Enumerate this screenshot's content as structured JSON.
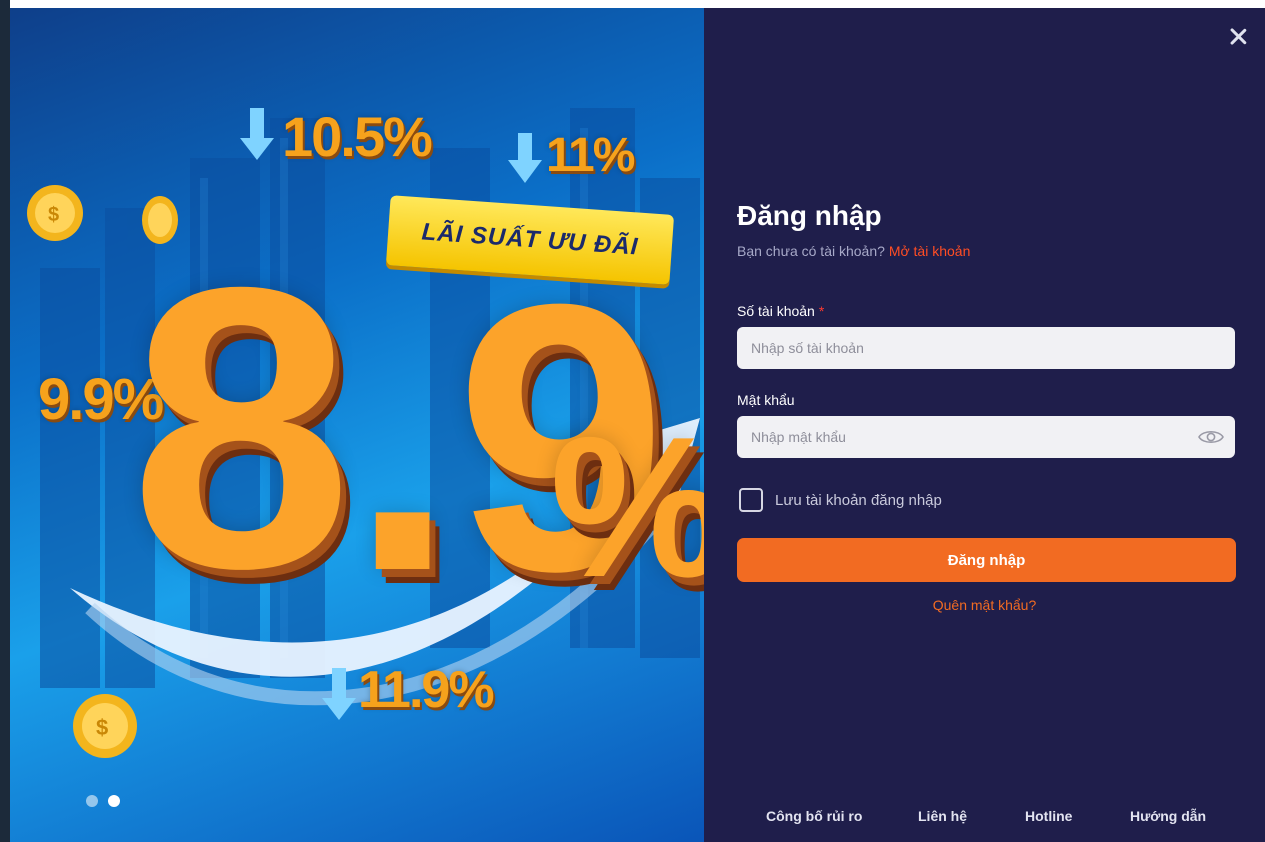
{
  "promo": {
    "ribbon_text": "LÃI SUẤT ƯU ĐÃI",
    "big_rate_integer": "8",
    "big_rate_decimal": ".9",
    "big_percent": "%",
    "rates": [
      "10.5%",
      "11%",
      "9.9%",
      "11.9%"
    ],
    "carousel": {
      "total": 2,
      "active_index": 1
    }
  },
  "login": {
    "title": "Đăng nhập",
    "no_account_text": "Bạn chưa có tài khoản?",
    "open_account_link": "Mở tài khoản",
    "account_label": "Số tài khoản",
    "required_mark": "*",
    "account_placeholder": "Nhập số tài khoản",
    "password_label": "Mật khẩu",
    "password_placeholder": "Nhập mật khẩu",
    "remember_label": "Lưu tài khoản đăng nhập",
    "remember_checked": false,
    "submit_label": "Đăng nhập",
    "forgot_link": "Quên mật khẩu?"
  },
  "footer": {
    "links": [
      "Công bố rủi ro",
      "Liên hệ",
      "Hotline",
      "Hướng dẫn"
    ]
  },
  "colors": {
    "panel_bg": "#1f1e4b",
    "accent": "#f26b22",
    "link_red": "#ff4d24",
    "input_bg": "#f1f1f4"
  },
  "icons": [
    "close-icon",
    "eye-icon",
    "coin-icon",
    "arrow-down-icon"
  ]
}
